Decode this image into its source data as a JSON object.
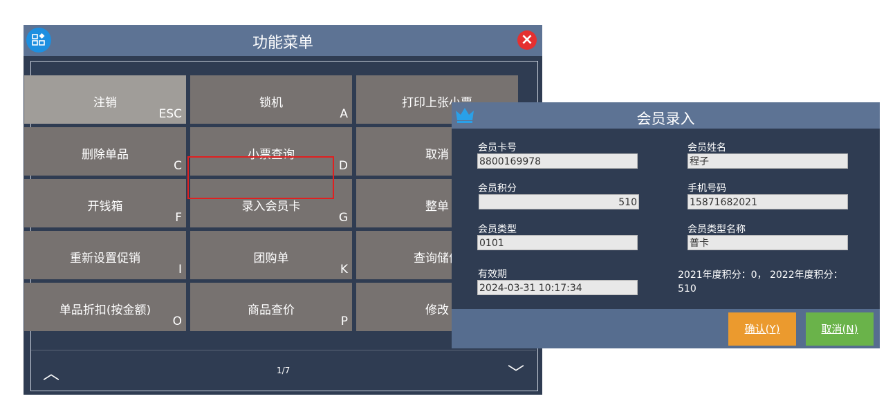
{
  "menu": {
    "title": "功能菜单",
    "close_glyph": "×",
    "tiles": [
      {
        "label": "注销",
        "key": "ESC",
        "selected": true
      },
      {
        "label": "锁机",
        "key": "A"
      },
      {
        "label": "打印上张小票",
        "key": ""
      },
      {
        "label": "删除单品",
        "key": "C"
      },
      {
        "label": "小票查询",
        "key": "D"
      },
      {
        "label": "取消",
        "key": ""
      },
      {
        "label": "开钱箱",
        "key": "F"
      },
      {
        "label": "录入会员卡",
        "key": "G"
      },
      {
        "label": "整单",
        "key": ""
      },
      {
        "label": "重新设置促销",
        "key": "I"
      },
      {
        "label": "团购单",
        "key": "K"
      },
      {
        "label": "查询储值",
        "key": ""
      },
      {
        "label": "单品折扣(按金额)",
        "key": "O"
      },
      {
        "label": "商品查价",
        "key": "P"
      },
      {
        "label": "修改",
        "key": ""
      }
    ],
    "pager": {
      "text": "1/7",
      "up_glyph": "︿",
      "down_glyph": "﹀"
    }
  },
  "member": {
    "title": "会员录入",
    "card_no_label": "会员卡号",
    "card_no": "8800169978",
    "name_label": "会员姓名",
    "name": "程子",
    "points_label": "会员积分",
    "points": "510",
    "phone_label": "手机号码",
    "phone": "15871682021",
    "type_label": "会员类型",
    "type": "0101",
    "type_name_label": "会员类型名称",
    "type_name": "普卡",
    "expiry_label": "有效期",
    "expiry": "2024-03-31 10:17:34",
    "points_note": "2021年度积分：0，  2022年度积分：510",
    "confirm_label": "确认(Y)",
    "cancel_label": "取消(N)"
  },
  "colors": {
    "accent": "#eb9a2e",
    "confirm": "#eb9a2e",
    "cancel": "#6ab34a",
    "close": "#e53030"
  }
}
